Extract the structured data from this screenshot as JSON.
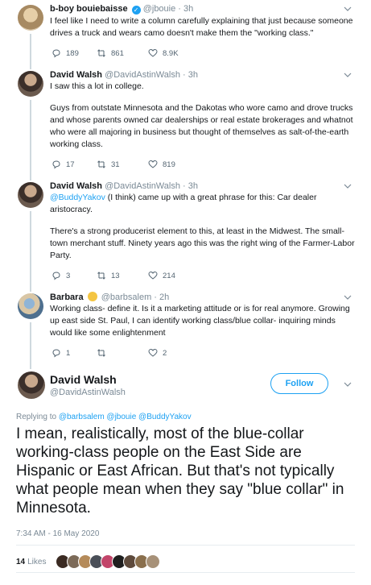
{
  "thread": [
    {
      "name": "b-boy bouiebaisse",
      "handle": "@jbouie",
      "time": "3h",
      "text": [
        "I feel like I need to write a column carefully explaining that just because someone drives a truck and wears camo doesn't make them the \"working class.\""
      ],
      "replies": "189",
      "retweets": "861",
      "likes": "8.9K"
    },
    {
      "name": "David Walsh",
      "handle": "@DavidAstinWalsh",
      "time": "3h",
      "text": [
        "I saw this a lot in college.",
        "Guys from outstate Minnesota and the Dakotas who wore camo and drove trucks and whose parents owned car dealerships or real estate brokerages and whatnot who were all majoring in business but thought of themselves as salt-of-the-earth working class."
      ],
      "replies": "17",
      "retweets": "31",
      "likes": "819"
    },
    {
      "name": "David Walsh",
      "handle": "@DavidAstinWalsh",
      "time": "3h",
      "mention": "@BuddyYakov",
      "text": [
        " (I think) came up with a great phrase for this: Car dealer aristocracy.",
        "There's a strong producerist element to this, at least in the Midwest. The small-town merchant stuff. Ninety years ago this was the right wing of the Farmer-Labor Party."
      ],
      "replies": "3",
      "retweets": "13",
      "likes": "214"
    },
    {
      "name": "Barbara",
      "handle": "@barbsalem",
      "time": "2h",
      "text": [
        "Working class- define it. Is it a marketing attitude or is for real anymore. Growing up east side  St. Paul, I can identify working class/blue collar- inquiring minds would like some enlightenment"
      ],
      "replies": "1",
      "retweets": "",
      "likes": "2"
    }
  ],
  "main_tweet": {
    "name": "David Walsh",
    "handle": "@DavidAstinWalsh",
    "follow_label": "Follow",
    "replying_prefix": "Replying to ",
    "replying_to": "@barbsalem @jbouie @BuddyYakov",
    "text": "I mean, realistically, most of the blue-collar working-class people on the East Side are Hispanic or East African. But that's not typically what people mean when they say \"blue collar\" in Minnesota.",
    "timestamp": "7:34 AM - 16 May 2020",
    "likes_count": "14",
    "likes_label": "Likes"
  },
  "colors": {
    "accent": "#1da1f2",
    "secondary_text": "#7b8a96",
    "primary_text": "#14171a"
  }
}
